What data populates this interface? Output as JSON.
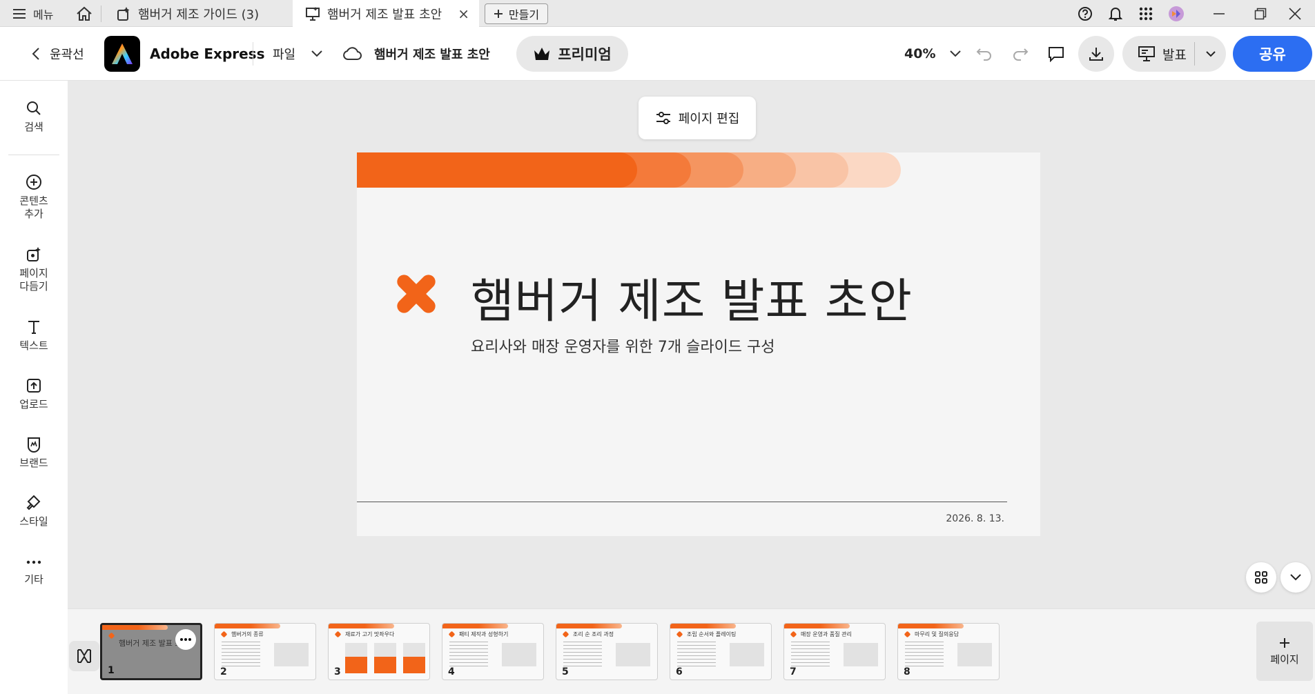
{
  "tabbar": {
    "menu_label": "메뉴",
    "tabs": [
      {
        "label": "햄버거 제조 가이드 (3)"
      },
      {
        "label": "햄버거 제조 발표 초안"
      }
    ],
    "close_glyph": "×",
    "new_tab_label": "만들기"
  },
  "appbar": {
    "back_label": "윤곽선",
    "app_name": "Adobe Express",
    "file_menu": "파일",
    "doc_title": "햄버거 제조 발표 초안",
    "premium_label": "프리미엄",
    "zoom": "40%",
    "present_label": "발표",
    "share_label": "공유"
  },
  "rail": {
    "items": [
      {
        "label": "검색",
        "icon": "search-icon"
      },
      {
        "label": "콘텐츠\n추가",
        "icon": "add-content-icon"
      },
      {
        "label": "페이지\n다듬기",
        "icon": "refine-page-icon"
      },
      {
        "label": "텍스트",
        "icon": "text-icon"
      },
      {
        "label": "업로드",
        "icon": "upload-icon"
      },
      {
        "label": "브랜드",
        "icon": "brand-icon"
      },
      {
        "label": "스타일",
        "icon": "style-icon"
      },
      {
        "label": "기타",
        "icon": "more-icon"
      }
    ]
  },
  "canvas": {
    "edit_page_label": "페이지 편집",
    "slide": {
      "title": "햄버거 제조 발표 초안",
      "subtitle": "요리사와 매장 운영자를 위한 7개 슬라이드 구성",
      "date": "2026. 8. 13.",
      "accent_colors": [
        "#f26419",
        "#f47a3a",
        "#f59560",
        "#f7ae84",
        "#f9c4a6",
        "#fbd8c4"
      ]
    }
  },
  "filmstrip": {
    "thumbs": [
      {
        "num": "1",
        "title": "햄버거 제조 발표 초안"
      },
      {
        "num": "2",
        "title": "햄버거의 종류"
      },
      {
        "num": "3",
        "title": "재료가 고기 맛좌우다"
      },
      {
        "num": "4",
        "title": "패티 제작과 성형하기"
      },
      {
        "num": "5",
        "title": "조리 순 조리 과정"
      },
      {
        "num": "6",
        "title": "조립 순서와 플레이팅"
      },
      {
        "num": "7",
        "title": "매장 운영과 품질 관리"
      },
      {
        "num": "8",
        "title": "마무리 및 질의응답"
      }
    ],
    "add_page_label": "페이지"
  }
}
